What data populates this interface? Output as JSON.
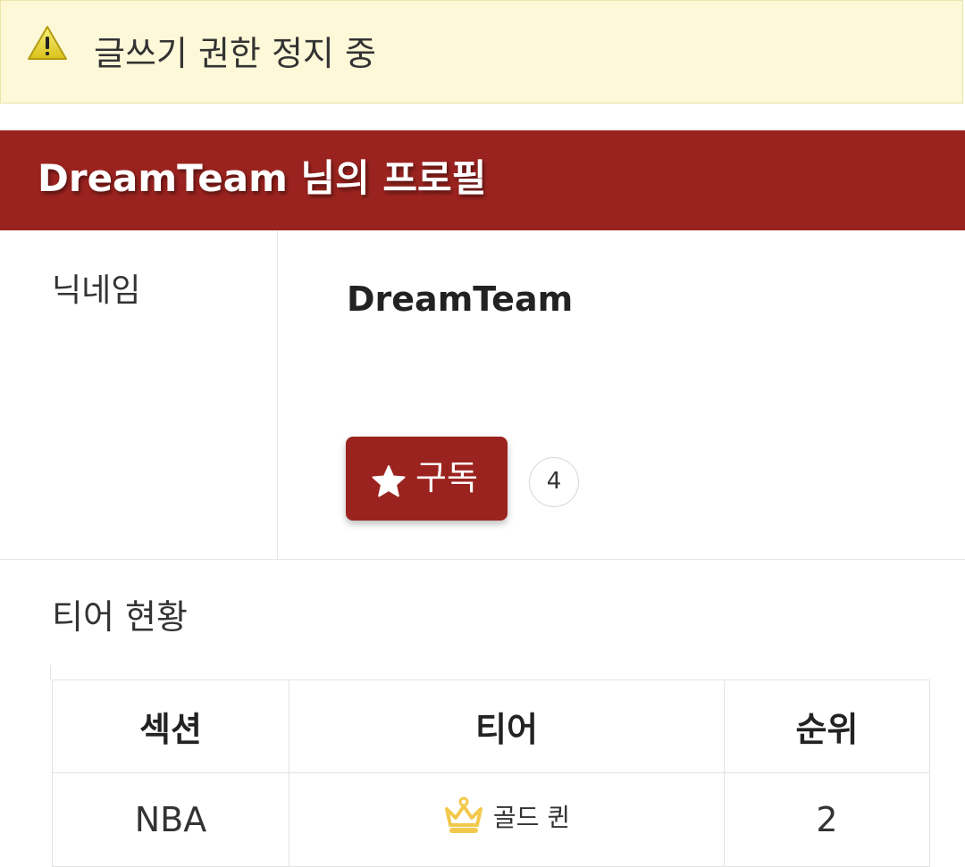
{
  "alert": {
    "icon": "warning-icon",
    "text": "글쓰기 권한 정지 중"
  },
  "header": {
    "title": "DreamTeam 님의 프로필"
  },
  "profile": {
    "nickname_label": "닉네임",
    "nickname_value": "DreamTeam",
    "subscribe_icon": "star-icon",
    "subscribe_label": "구독",
    "subscriber_count": "4"
  },
  "tier": {
    "title": "티어 현황",
    "columns": [
      "섹션",
      "티어",
      "순위"
    ],
    "rows": [
      {
        "section": "NBA",
        "tier_icon": "crown-icon",
        "tier": "골드 퀸",
        "rank": "2"
      }
    ]
  },
  "colors": {
    "accent": "#9b231f",
    "alert_bg": "#fcf8d8",
    "crown": "#f2c94c"
  }
}
